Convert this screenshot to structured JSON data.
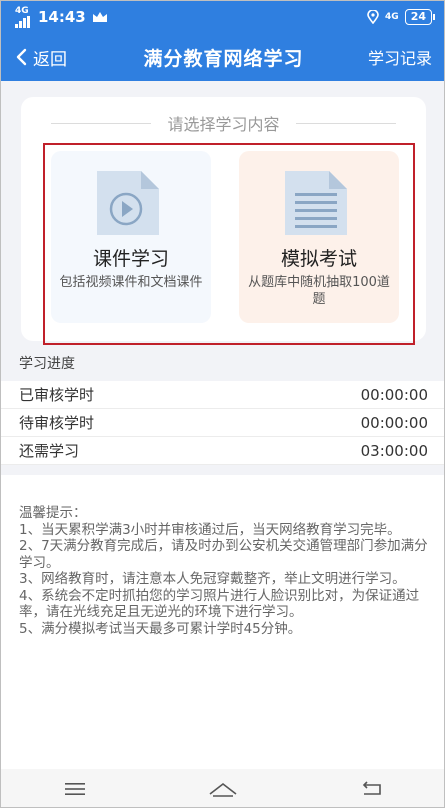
{
  "status_bar": {
    "network": "4G",
    "time": "14:43",
    "network_right": "4G",
    "battery": "24"
  },
  "header": {
    "back_label": "返回",
    "title": "满分教育网络学习",
    "record_label": "学习记录"
  },
  "selection": {
    "title": "请选择学习内容",
    "options": [
      {
        "name": "课件学习",
        "desc": "包括视频课件和文档课件",
        "icon": "video-document-icon"
      },
      {
        "name": "模拟考试",
        "desc": "从题库中随机抽取100道题",
        "icon": "text-document-icon"
      }
    ]
  },
  "progress": {
    "label": "学习进度",
    "rows": [
      {
        "label": "已审核学时",
        "value": "00:00:00"
      },
      {
        "label": "待审核学时",
        "value": "00:00:00"
      },
      {
        "label": "还需学习",
        "value": "03:00:00"
      }
    ]
  },
  "tips": {
    "title": "温馨提示：",
    "items": [
      "1、当天累积学满3小时并审核通过后，当天网络教育学习完毕。",
      "2、7天满分教育完成后，请及时办到公安机关交通管理部门参加满分学习。",
      "3、网络教育时，请注意本人免冠穿戴整齐，举止文明进行学习。",
      "4、系统会不定时抓拍您的学习照片进行人脸识别比对，为保证通过率，请在光线充足且无逆光的环境下进行学习。",
      "5、满分模拟考试当天最多可累计学时45分钟。"
    ]
  },
  "colors": {
    "primary": "#2f7fe0",
    "highlight_border": "#c0202a",
    "course_bg": "#f4f8fd",
    "exam_bg": "#fdf1ea"
  },
  "nav": [
    "menu-icon",
    "home-icon",
    "back-icon"
  ]
}
